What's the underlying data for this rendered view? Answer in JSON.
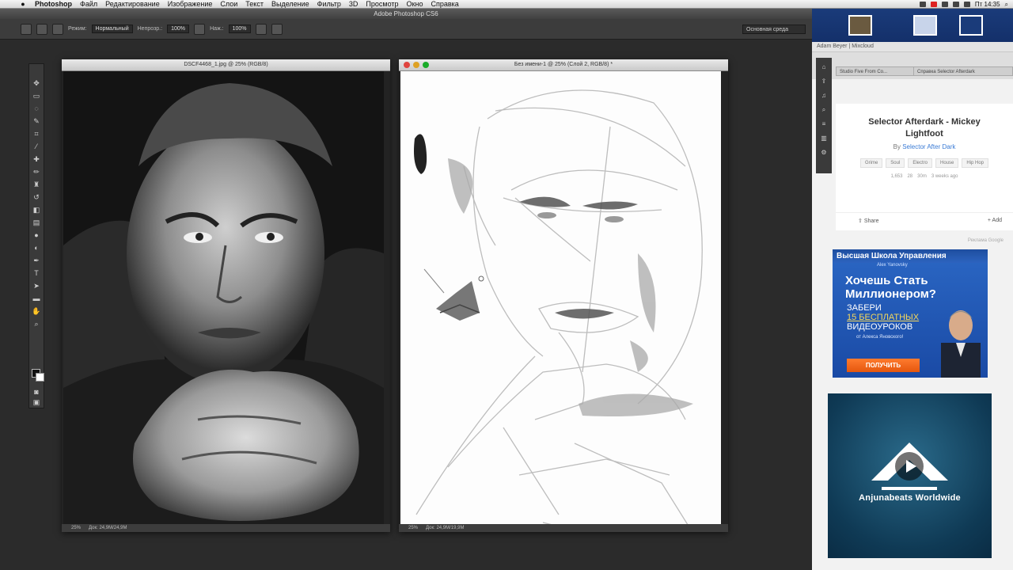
{
  "menubar": {
    "apple": "",
    "items": [
      "Photoshop",
      "Файл",
      "Редактирование",
      "Изображение",
      "Слои",
      "Текст",
      "Выделение",
      "Фильтр",
      "3D",
      "Просмотр",
      "Окно",
      "Справка"
    ],
    "clock": "Пт 14:35"
  },
  "app": {
    "title": "Adobe Photoshop CS6"
  },
  "options": {
    "mode_label": "Режим:",
    "mode_value": "Нормальный",
    "opacity_label": "Непрозр.:",
    "opacity_value": "100%",
    "flow_label": "Наж.:",
    "flow_value": "100%",
    "workspace": "Основная среда"
  },
  "documents": {
    "left": {
      "title": "DSCF4468_1.jpg @ 25% (RGB/8)",
      "zoom": "25%",
      "doc_size": "Док: 24,9M/24,9M"
    },
    "right": {
      "title": "Без имени-1 @ 25% (Слой 2, RGB/8) *",
      "zoom": "25%",
      "doc_size": "Док: 24,9M/19,9M"
    }
  },
  "browser": {
    "page_title": "Adam Beyer | Mixcloud",
    "tabs": [
      "Studio Five From Co...",
      "Справка Selector Afterdark"
    ],
    "track": {
      "title": "Selector Afterdark - Mickey Lightfoot",
      "by_prefix": "By",
      "artist": "Selector After Dark",
      "tags": [
        "Grime",
        "Soul",
        "Electro",
        "House",
        "Hip Hop"
      ],
      "stats": [
        "1,653",
        "28",
        "30m",
        "3 weeks ago"
      ]
    },
    "actions": {
      "share": "Share",
      "add": "Add"
    },
    "ad_caption": "Реклама Google",
    "ad": {
      "header": "Высшая Школа Управления",
      "sub": "Alex Yanovsky",
      "headline": "Хочешь Стать Миллионером?",
      "body1": "ЗАБЕРИ",
      "body2": "15 БЕСПЛАТНЫХ",
      "body3": "ВИДЕОУРОКОВ",
      "note": "от Алекса Яновского!",
      "cta": "ПОЛУЧИТЬ"
    },
    "video": {
      "title": "Anjunabeats Worldwide"
    }
  },
  "colors": {
    "ps_bg": "#2b2b2b",
    "ad_blue": "#2b67c4",
    "ad_cta": "#ff7b2e",
    "link": "#3a7bd5"
  }
}
